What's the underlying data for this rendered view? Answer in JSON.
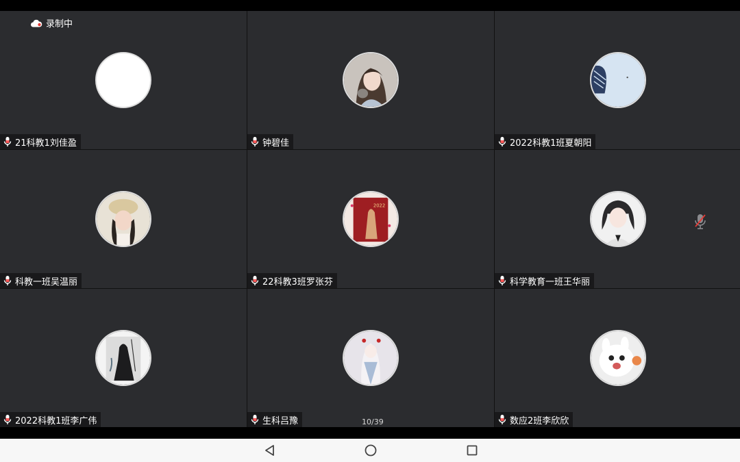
{
  "recording": {
    "label": "录制中"
  },
  "pagination": {
    "label": "10/39"
  },
  "participants": [
    {
      "name": "21科教1刘佳盈"
    },
    {
      "name": "钟碧佳"
    },
    {
      "name": "2022科教1班夏朝阳"
    },
    {
      "name": "科教一班吴温丽"
    },
    {
      "name": "22科教3班罗张芬"
    },
    {
      "name": "科学教育一班王华丽"
    },
    {
      "name": "2022科教1班李广伟"
    },
    {
      "name": "生科吕豫"
    },
    {
      "name": "数应2班李欣欣"
    }
  ],
  "icons": {
    "recording": "cloud-icon",
    "mic": "microphone-icon",
    "muted": "microphone-muted-icon",
    "nav_back": "triangle-back-icon",
    "nav_home": "circle-home-icon",
    "nav_recent": "square-recent-icon"
  },
  "colors": {
    "tile_bg": "#2b2c2f",
    "mic_accent": "#ff5a5a",
    "nav_bar_bg": "#f7f7f7"
  }
}
